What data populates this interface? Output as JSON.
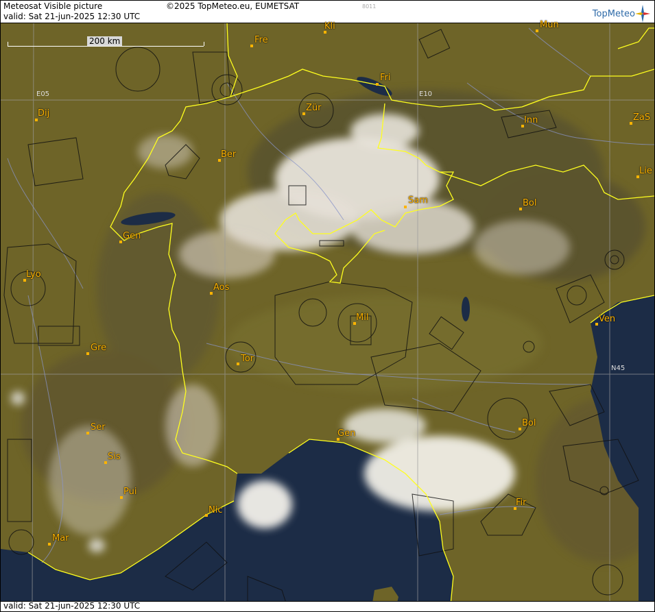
{
  "header": {
    "title": "Meteosat Visible picture",
    "valid": "valid:  Sat  21-jun-2025  12:30 UTC",
    "copyright": "©2025 TopMeteo.eu, EUMETSAT",
    "code": "8011",
    "logo": "TopMeteo"
  },
  "footer": {
    "valid": "valid:  Sat  21-jun-2025  12:30 UTC"
  },
  "scale": {
    "label": "200 km"
  },
  "grid": {
    "lon1": "E05",
    "lon2": "E10",
    "lat1": "N45"
  },
  "cities": [
    {
      "name": "Kli"
    },
    {
      "name": "Mun"
    },
    {
      "name": "Fre"
    },
    {
      "name": "Fri"
    },
    {
      "name": "Dij"
    },
    {
      "name": "Zür"
    },
    {
      "name": "Inn"
    },
    {
      "name": "ZaS"
    },
    {
      "name": "Ber"
    },
    {
      "name": "Lie"
    },
    {
      "name": "Sam"
    },
    {
      "name": "Bol"
    },
    {
      "name": "Gen"
    },
    {
      "name": "Lyo"
    },
    {
      "name": "Aos"
    },
    {
      "name": "Mil"
    },
    {
      "name": "Ven"
    },
    {
      "name": "Gre"
    },
    {
      "name": "Tor"
    },
    {
      "name": "Ser"
    },
    {
      "name": "Bol"
    },
    {
      "name": "Gen"
    },
    {
      "name": "Sis"
    },
    {
      "name": "Pui"
    },
    {
      "name": "Fir"
    },
    {
      "name": "Nic"
    },
    {
      "name": "Mar"
    }
  ],
  "colors": {
    "land": "#6e6428",
    "sea": "#1c2c46",
    "border": "#ffff1e",
    "city": "#ffb400"
  }
}
